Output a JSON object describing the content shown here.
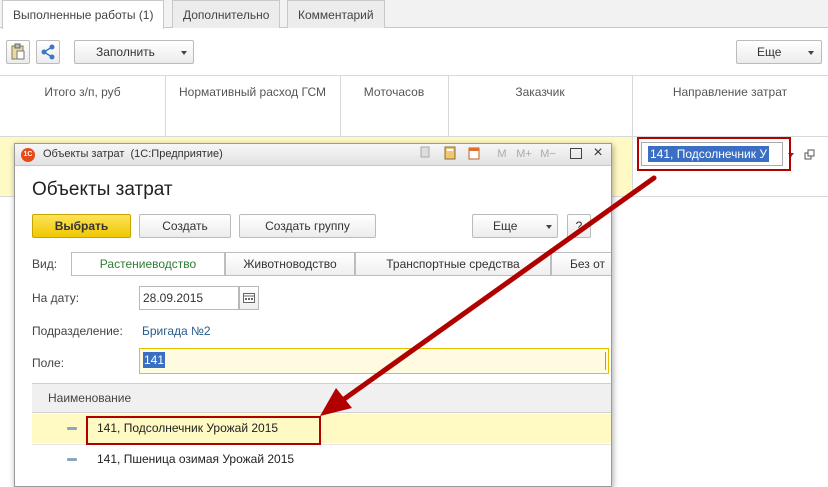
{
  "tabs": [
    "Выполненные работы (1)",
    "Дополнительно",
    "Комментарий"
  ],
  "toolbar": {
    "fill_label": "Заполнить",
    "more_label": "Еще"
  },
  "columns": [
    "Итого з/п, руб",
    "Нормативный расход ГСМ",
    "Моточасов",
    "Заказчик",
    "Направление затрат"
  ],
  "cell_value": "141, Подсолнечник У",
  "dialog": {
    "window_title": "Объекты затрат  (1С:Предприятие)",
    "app_icon_text": "1С",
    "window_buttons": [
      "M",
      "M+",
      "M−"
    ],
    "heading": "Объекты затрат",
    "buttons": {
      "select": "Выбрать",
      "create": "Создать",
      "create_group": "Создать группу",
      "more": "Еще",
      "help": "?"
    },
    "view_label": "Вид:",
    "view_tabs": [
      "Растениеводство",
      "Животноводство",
      "Транспортные средства",
      "Без от"
    ],
    "date_label": "На дату:",
    "date_value": "28.09.2015",
    "division_label": "Подразделение:",
    "division_value": "Бригада №2",
    "field_label": "Поле:",
    "field_value": "141",
    "list_header": "Наименование",
    "rows": [
      "141, Подсолнечник Урожай 2015",
      "141, Пшеница озимая Урожай 2015"
    ]
  },
  "colors": {
    "accent_red": "#b00000",
    "highlight_yellow": "#fff9c4",
    "select_button": "#f5d000",
    "link_blue": "#2a5a8a",
    "tab_green": "#2e7d32"
  }
}
